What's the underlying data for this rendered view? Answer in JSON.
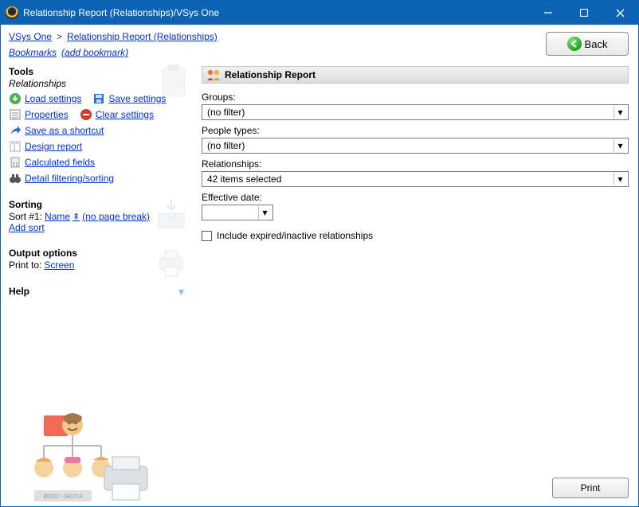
{
  "window": {
    "title": "Relationship Report (Relationships)/VSys One"
  },
  "breadcrumb": {
    "root": "VSys One",
    "sep": ">",
    "current": "Relationship Report (Relationships)"
  },
  "bookmarks": {
    "label": "Bookmarks",
    "add": "(add bookmark)"
  },
  "back_button": {
    "label": "Back"
  },
  "tools": {
    "heading": "Tools",
    "subheading": "Relationships",
    "load": "Load settings",
    "save": "Save settings",
    "properties": "Properties",
    "clear": "Clear settings",
    "shortcut": "Save as a shortcut",
    "design": "Design report",
    "calc": "Calculated fields",
    "detail": "Detail filtering/sorting"
  },
  "sorting": {
    "heading": "Sorting",
    "row_prefix": "Sort #1:",
    "field": "Name",
    "pagebreak": "(no page break)",
    "add": "Add sort"
  },
  "output": {
    "heading": "Output options",
    "print_to_label": "Print to:",
    "print_to_value": "Screen"
  },
  "help": {
    "heading": "Help"
  },
  "panel": {
    "title": "Relationship Report",
    "groups_label": "Groups:",
    "groups_value": "(no filter)",
    "people_label": "People types:",
    "people_value": "(no filter)",
    "rel_label": "Relationships:",
    "rel_value": "42 items selected",
    "eff_label": "Effective date:",
    "eff_value": "",
    "include_label": "Include expired/inactive relationships"
  },
  "print_button": {
    "label": "Print"
  }
}
